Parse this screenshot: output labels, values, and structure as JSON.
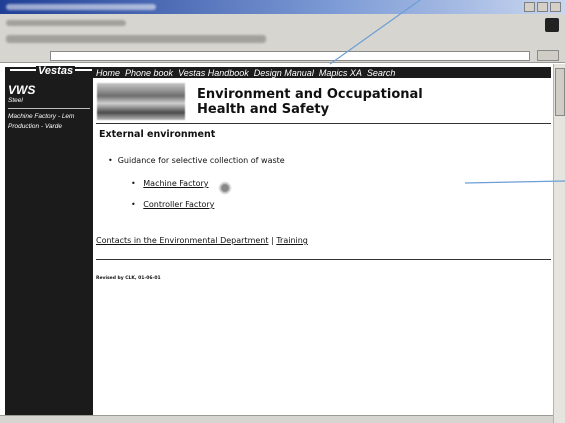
{
  "sidebar": {
    "logo": "Vestas",
    "title": "VWS",
    "subtitle": "Steel",
    "links": [
      "Machine Factory - Lem",
      "Production - Varde"
    ]
  },
  "topnav": [
    "Home",
    "Phone book",
    "Vestas Handbook",
    "Design Manual",
    "Mapics XA",
    "Search"
  ],
  "header": {
    "title_line1": "Environment and Occupational",
    "title_line2": "Health and Safety"
  },
  "content": {
    "section_title": "External environment",
    "bullet": "Guidance for selective collection of waste",
    "sub_links": [
      "Machine Factory",
      "Controller Factory"
    ],
    "contacts_link": "Contacts in the Environmental Department",
    "separator": "|",
    "training_link": "Training",
    "revised": "Revised by CLK, 01-06-01"
  },
  "colors": {
    "sidebar_bg": "#1b1b1b",
    "annotation_line": "#6b9fd6"
  },
  "icons": [
    "cursor-icon",
    "header-image"
  ]
}
